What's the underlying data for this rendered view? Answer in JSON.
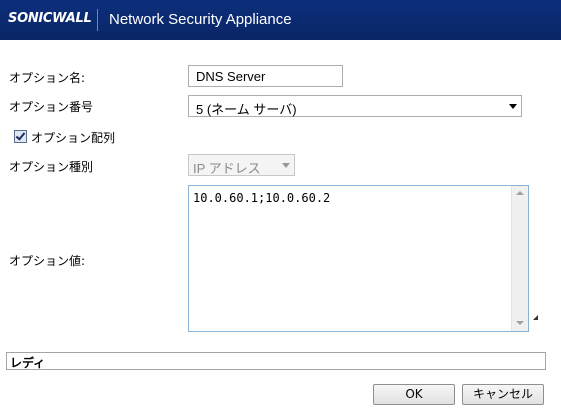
{
  "header": {
    "logo": "SONICWALL",
    "title": "Network Security Appliance"
  },
  "form": {
    "option_name_label": "オプション名:",
    "option_name_value": "DNS Server",
    "option_number_label": "オプション番号",
    "option_number_value": "5 (ネーム サーバ)",
    "option_array_label": "オプション配列",
    "option_array_checked": true,
    "option_type_label": "オプション種別",
    "option_type_value": "IP アドレス",
    "option_value_label": "オプション値:",
    "option_value_text": "10.0.60.1;10.0.60.2"
  },
  "status": {
    "text": "レディ"
  },
  "buttons": {
    "ok": "OK",
    "cancel": "キャンセル"
  },
  "icons": {
    "dropdown": "chevron-down-icon",
    "check": "check-icon"
  }
}
